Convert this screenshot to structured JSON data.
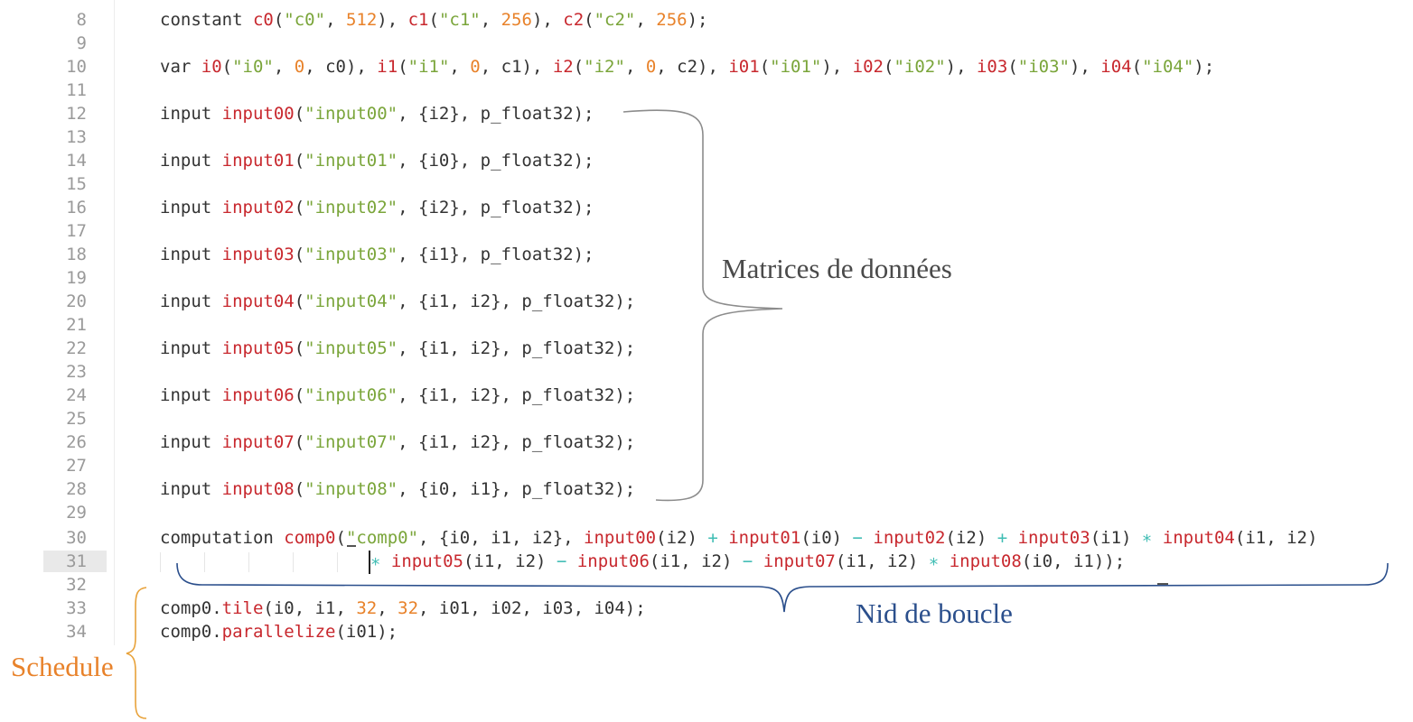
{
  "editor": {
    "line_numbers": [
      "8",
      "9",
      "10",
      "11",
      "12",
      "13",
      "14",
      "15",
      "16",
      "17",
      "18",
      "19",
      "20",
      "21",
      "22",
      "23",
      "24",
      "25",
      "26",
      "27",
      "28",
      "29",
      "30",
      "31",
      "32",
      "33",
      "34"
    ],
    "active_line": "31",
    "lines": {
      "l8": [
        [
          "k",
          "constant "
        ],
        [
          "id",
          "c0"
        ],
        [
          "p",
          "("
        ],
        [
          "str",
          "\"c0\""
        ],
        [
          "p",
          ", "
        ],
        [
          "num",
          "512"
        ],
        [
          "p",
          "), "
        ],
        [
          "id",
          "c1"
        ],
        [
          "p",
          "("
        ],
        [
          "str",
          "\"c1\""
        ],
        [
          "p",
          ", "
        ],
        [
          "num",
          "256"
        ],
        [
          "p",
          "), "
        ],
        [
          "id",
          "c2"
        ],
        [
          "p",
          "("
        ],
        [
          "str",
          "\"c2\""
        ],
        [
          "p",
          ", "
        ],
        [
          "num",
          "256"
        ],
        [
          "p",
          ");"
        ]
      ],
      "l10": [
        [
          "k",
          "var "
        ],
        [
          "id",
          "i0"
        ],
        [
          "p",
          "("
        ],
        [
          "str",
          "\"i0\""
        ],
        [
          "p",
          ", "
        ],
        [
          "num",
          "0"
        ],
        [
          "p",
          ", c0), "
        ],
        [
          "id",
          "i1"
        ],
        [
          "p",
          "("
        ],
        [
          "str",
          "\"i1\""
        ],
        [
          "p",
          ", "
        ],
        [
          "num",
          "0"
        ],
        [
          "p",
          ", c1), "
        ],
        [
          "id",
          "i2"
        ],
        [
          "p",
          "("
        ],
        [
          "str",
          "\"i2\""
        ],
        [
          "p",
          ", "
        ],
        [
          "num",
          "0"
        ],
        [
          "p",
          ", c2), "
        ],
        [
          "id",
          "i01"
        ],
        [
          "p",
          "("
        ],
        [
          "str",
          "\"i01\""
        ],
        [
          "p",
          "), "
        ],
        [
          "id",
          "i02"
        ],
        [
          "p",
          "("
        ],
        [
          "str",
          "\"i02\""
        ],
        [
          "p",
          "), "
        ],
        [
          "id",
          "i03"
        ],
        [
          "p",
          "("
        ],
        [
          "str",
          "\"i03\""
        ],
        [
          "p",
          "), "
        ],
        [
          "id",
          "i04"
        ],
        [
          "p",
          "("
        ],
        [
          "str",
          "\"i04\""
        ],
        [
          "p",
          ");"
        ]
      ],
      "l12": [
        [
          "k",
          "input "
        ],
        [
          "id",
          "input00"
        ],
        [
          "p",
          "("
        ],
        [
          "str",
          "\"input00\""
        ],
        [
          "p",
          ", {i2}, p_float32);"
        ]
      ],
      "l14": [
        [
          "k",
          "input "
        ],
        [
          "id",
          "input01"
        ],
        [
          "p",
          "("
        ],
        [
          "str",
          "\"input01\""
        ],
        [
          "p",
          ", {i0}, p_float32);"
        ]
      ],
      "l16": [
        [
          "k",
          "input "
        ],
        [
          "id",
          "input02"
        ],
        [
          "p",
          "("
        ],
        [
          "str",
          "\"input02\""
        ],
        [
          "p",
          ", {i2}, p_float32);"
        ]
      ],
      "l18": [
        [
          "k",
          "input "
        ],
        [
          "id",
          "input03"
        ],
        [
          "p",
          "("
        ],
        [
          "str",
          "\"input03\""
        ],
        [
          "p",
          ", {i1}, p_float32);"
        ]
      ],
      "l20": [
        [
          "k",
          "input "
        ],
        [
          "id",
          "input04"
        ],
        [
          "p",
          "("
        ],
        [
          "str",
          "\"input04\""
        ],
        [
          "p",
          ", {i1, i2}, p_float32);"
        ]
      ],
      "l22": [
        [
          "k",
          "input "
        ],
        [
          "id",
          "input05"
        ],
        [
          "p",
          "("
        ],
        [
          "str",
          "\"input05\""
        ],
        [
          "p",
          ", {i1, i2}, p_float32);"
        ]
      ],
      "l24": [
        [
          "k",
          "input "
        ],
        [
          "id",
          "input06"
        ],
        [
          "p",
          "("
        ],
        [
          "str",
          "\"input06\""
        ],
        [
          "p",
          ", {i1, i2}, p_float32);"
        ]
      ],
      "l26": [
        [
          "k",
          "input "
        ],
        [
          "id",
          "input07"
        ],
        [
          "p",
          "("
        ],
        [
          "str",
          "\"input07\""
        ],
        [
          "p",
          ", {i1, i2}, p_float32);"
        ]
      ],
      "l28": [
        [
          "k",
          "input "
        ],
        [
          "id",
          "input08"
        ],
        [
          "p",
          "("
        ],
        [
          "str",
          "\"input08\""
        ],
        [
          "p",
          ", {i0, i1}, p_float32);"
        ]
      ],
      "l30": [
        [
          "k",
          "computation "
        ],
        [
          "id",
          "comp0"
        ],
        [
          "p",
          "("
        ],
        [
          "str",
          "\"comp0\""
        ],
        [
          "p",
          ", {i0, i1, i2}, "
        ],
        [
          "id",
          "input00"
        ],
        [
          "p",
          "(i2) "
        ],
        [
          "op",
          "+"
        ],
        [
          "p",
          " "
        ],
        [
          "id",
          "input01"
        ],
        [
          "p",
          "(i0) "
        ],
        [
          "op",
          "−"
        ],
        [
          "p",
          " "
        ],
        [
          "id",
          "input02"
        ],
        [
          "p",
          "(i2) "
        ],
        [
          "op",
          "+"
        ],
        [
          "p",
          " "
        ],
        [
          "id",
          "input03"
        ],
        [
          "p",
          "(i1) "
        ],
        [
          "op",
          "∗"
        ],
        [
          "p",
          " "
        ],
        [
          "id",
          "input04"
        ],
        [
          "p",
          "(i1, i2)"
        ]
      ],
      "l31": [
        [
          "op",
          "∗"
        ],
        [
          "p",
          " "
        ],
        [
          "id",
          "input05"
        ],
        [
          "p",
          "(i1, i2) "
        ],
        [
          "op",
          "−"
        ],
        [
          "p",
          " "
        ],
        [
          "id",
          "input06"
        ],
        [
          "p",
          "(i1, i2) "
        ],
        [
          "op",
          "−"
        ],
        [
          "p",
          " "
        ],
        [
          "id",
          "input07"
        ],
        [
          "p",
          "(i1, i2) "
        ],
        [
          "op",
          "∗"
        ],
        [
          "p",
          " "
        ],
        [
          "id",
          "input08"
        ],
        [
          "p",
          "(i0, i1));"
        ]
      ],
      "l33": [
        [
          "k",
          "comp0."
        ],
        [
          "id",
          "tile"
        ],
        [
          "p",
          "(i0, i1, "
        ],
        [
          "num",
          "32"
        ],
        [
          "p",
          ", "
        ],
        [
          "num",
          "32"
        ],
        [
          "p",
          ", i01, i02, i03, i04);"
        ]
      ],
      "l34": [
        [
          "k",
          "comp0."
        ],
        [
          "id",
          "parallelize"
        ],
        [
          "p",
          "(i01);"
        ]
      ]
    }
  },
  "annotations": {
    "matrices": "Matrices de données",
    "nid": "Nid de boucle",
    "schedule": "Schedule"
  },
  "colors": {
    "keyword": "#333333",
    "identifier": "#c8282e",
    "string": "#7aa53a",
    "number": "#e8822a",
    "operator": "#3fbdb4",
    "brace_gray": "#8c8c8c",
    "brace_blue": "#2b4f8c",
    "brace_orange": "#e8a23a"
  }
}
